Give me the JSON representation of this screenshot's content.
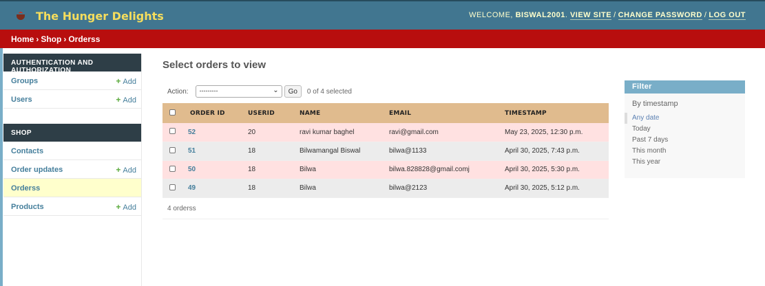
{
  "header": {
    "brand": "The Hunger Delights",
    "welcome": "Welcome,",
    "username": "biswal2001",
    "links": [
      "View site",
      "Change password",
      "Log out"
    ]
  },
  "breadcrumbs": [
    "Home",
    "Shop",
    "Orderss"
  ],
  "sidebar": {
    "modules": [
      {
        "caption": "Authentication and Authorization",
        "items": [
          {
            "label": "Groups",
            "add": "Add"
          },
          {
            "label": "Users",
            "add": "Add"
          }
        ]
      },
      {
        "caption": "Shop",
        "items": [
          {
            "label": "Contacts",
            "add": ""
          },
          {
            "label": "Order updates",
            "add": "Add"
          },
          {
            "label": "Orderss",
            "add": ""
          },
          {
            "label": "Products",
            "add": "Add"
          }
        ]
      }
    ]
  },
  "content": {
    "title": "Select orders to view",
    "action_label": "Action:",
    "action_value": "---------",
    "go": "Go",
    "selected": "0 of 4 selected",
    "columns": [
      "Order ID",
      "UserID",
      "Name",
      "Email",
      "Timestamp"
    ],
    "rows": [
      {
        "id": "52",
        "userid": "20",
        "name": "ravi kumar baghel",
        "email": "ravi@gmail.com",
        "timestamp": "May 23, 2025, 12:30 p.m."
      },
      {
        "id": "51",
        "userid": "18",
        "name": "Bilwamangal Biswal",
        "email": "bilwa@1133",
        "timestamp": "April 30, 2025, 7:43 p.m."
      },
      {
        "id": "50",
        "userid": "18",
        "name": "Bilwa",
        "email": "bilwa.828828@gmail.comj",
        "timestamp": "April 30, 2025, 5:30 p.m."
      },
      {
        "id": "49",
        "userid": "18",
        "name": "Bilwa",
        "email": "bilwa@2123",
        "timestamp": "April 30, 2025, 5:12 p.m."
      }
    ],
    "paginator": "4 orderss"
  },
  "filter": {
    "title": "Filter",
    "subtitle": "By timestamp",
    "options": [
      "Any date",
      "Today",
      "Past 7 days",
      "This month",
      "This year"
    ],
    "selected": "Any date"
  },
  "colors": {
    "header": "#417690",
    "brand": "#f5dd5d",
    "breadcrumbs": "#b80e0e",
    "table_header": "#e0bb8e",
    "row_pink": "#ffe1e1",
    "row_grey": "#ececec",
    "filter_header": "#79aec8"
  }
}
